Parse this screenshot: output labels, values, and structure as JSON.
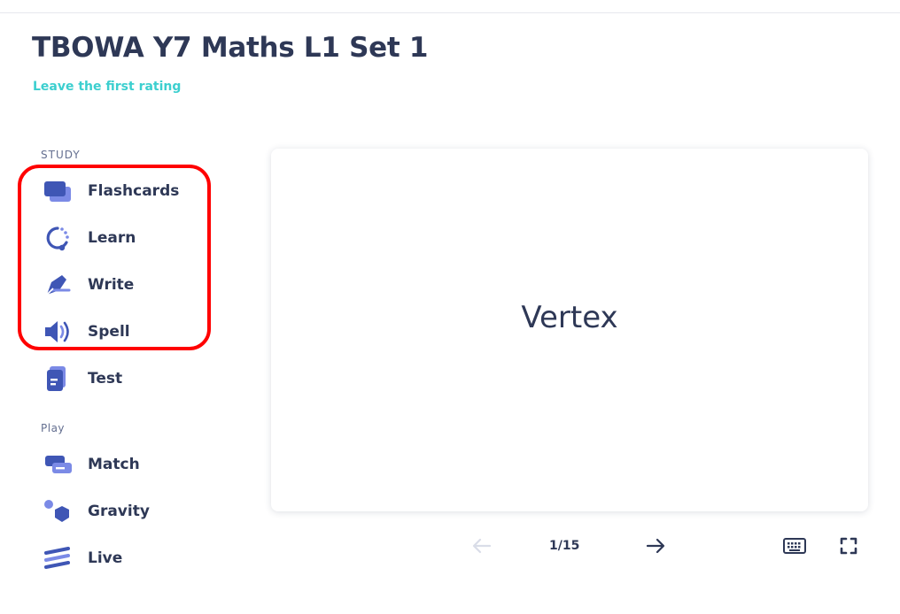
{
  "set": {
    "title": "TBOWA Y7 Maths L1 Set 1",
    "rating_link": "Leave the first rating"
  },
  "sidebar": {
    "study_label": "STUDY",
    "play_label": "Play",
    "study_items": [
      {
        "label": "Flashcards",
        "icon": "flashcards-icon"
      },
      {
        "label": "Learn",
        "icon": "learn-icon"
      },
      {
        "label": "Write",
        "icon": "write-icon"
      },
      {
        "label": "Spell",
        "icon": "spell-icon"
      },
      {
        "label": "Test",
        "icon": "test-icon"
      }
    ],
    "play_items": [
      {
        "label": "Match",
        "icon": "match-icon"
      },
      {
        "label": "Gravity",
        "icon": "gravity-icon"
      },
      {
        "label": "Live",
        "icon": "live-icon"
      }
    ]
  },
  "card": {
    "term": "Vertex"
  },
  "controls": {
    "counter": "1/15",
    "prev_icon": "arrow-left-icon",
    "next_icon": "arrow-right-icon",
    "keyboard_icon": "keyboard-icon",
    "fullscreen_icon": "fullscreen-icon"
  },
  "colors": {
    "primary": "#4255ff",
    "icon_blue": "#3f56b5",
    "icon_light": "#7b8ae6",
    "link": "#3ccfcf",
    "text": "#2e3856",
    "highlight": "#ff0000"
  }
}
